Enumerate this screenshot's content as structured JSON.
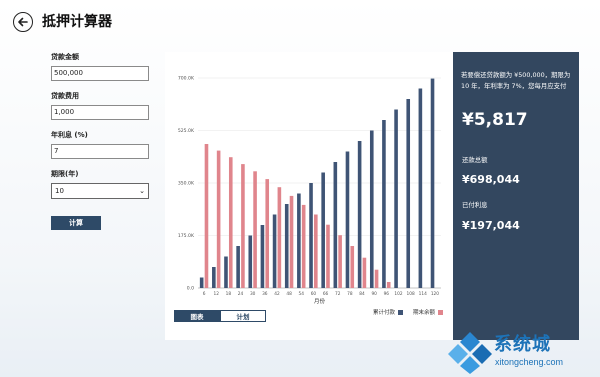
{
  "app": {
    "title": "抵押计算器"
  },
  "form": {
    "loan_amount_label": "贷款金额",
    "loan_amount_value": "500,000",
    "loan_fee_label": "贷款费用",
    "loan_fee_value": "1,000",
    "rate_label": "年利息 (%)",
    "rate_value": "7",
    "term_label": "期限(年)",
    "term_value": "10",
    "calc_label": "计算"
  },
  "result": {
    "description": "若要偿还贷款额为 ¥500,000，期限为 10 年，年利率为 7%，您每月应支付",
    "monthly_payment": "¥5,817",
    "total_label": "还款总额",
    "total_value": "¥698,044",
    "interest_label": "已付利息",
    "interest_value": "¥197,044"
  },
  "tabs": [
    {
      "label": "图表",
      "active": true
    },
    {
      "label": "计划",
      "active": false
    }
  ],
  "colors": {
    "series_paid": "#3f5475",
    "series_balance": "#e0858c",
    "dark_panel": "#33475f",
    "button": "#2e4a67"
  },
  "chart_data": {
    "type": "bar",
    "xlabel": "月份",
    "ylabel": "",
    "categories": [
      "6",
      "12",
      "18",
      "24",
      "30",
      "36",
      "42",
      "48",
      "54",
      "60",
      "66",
      "72",
      "78",
      "84",
      "90",
      "96",
      "102",
      "108",
      "114",
      "120"
    ],
    "ylim": [
      0,
      700000
    ],
    "y_ticks": [
      {
        "value": 0,
        "label": "0.0"
      },
      {
        "value": 175000,
        "label": "175.0K"
      },
      {
        "value": 350000,
        "label": "350.0K"
      },
      {
        "value": 525000,
        "label": "525.0K"
      },
      {
        "value": 700000,
        "label": "700.0K"
      }
    ],
    "series": [
      {
        "name": "累计付款",
        "color": "#3f5475",
        "values": [
          35000,
          70000,
          105000,
          140000,
          175000,
          210000,
          245000,
          280000,
          315000,
          350000,
          385000,
          420000,
          455000,
          490000,
          525000,
          560000,
          595000,
          630000,
          665000,
          698044
        ]
      },
      {
        "name": "期末余额",
        "color": "#e0858c",
        "values": [
          480000,
          458000,
          436000,
          413000,
          389000,
          363000,
          336000,
          307000,
          277000,
          245000,
          211000,
          176000,
          140000,
          101000,
          61000,
          20000,
          0,
          0,
          0,
          0
        ]
      }
    ],
    "legend_position": "bottom-right",
    "grid": true
  },
  "watermark": {
    "text": "系统城",
    "url": "xitongcheng.com"
  }
}
